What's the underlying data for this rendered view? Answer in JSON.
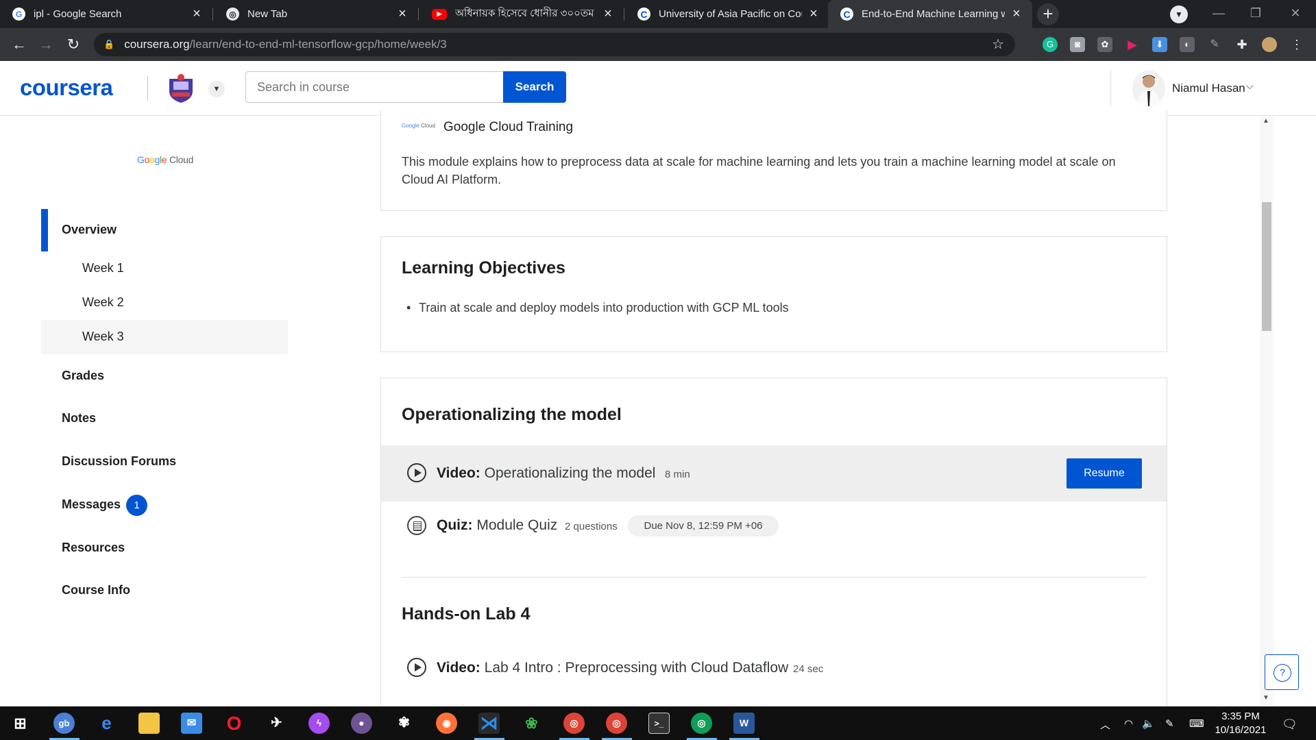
{
  "browser": {
    "tabs": [
      {
        "title": "ipl - Google Search",
        "favicon": "google-icon",
        "active": false
      },
      {
        "title": "New Tab",
        "favicon": "chrome-icon",
        "active": false
      },
      {
        "title": "অধিনায়ক হিসেবে ধোনীর ৩০০তম",
        "favicon": "youtube-icon",
        "active": false
      },
      {
        "title": "University of Asia Pacific on Cour",
        "favicon": "coursera-icon",
        "active": false
      },
      {
        "title": "End-to-End Machine Learning wi",
        "favicon": "coursera-icon",
        "active": true
      }
    ],
    "url_host": "coursera.org",
    "url_path": "/learn/end-to-end-ml-tensorflow-gcp/home/week/3"
  },
  "header": {
    "logo": "coursera",
    "search_placeholder": "Search in course",
    "search_button": "Search",
    "user_name": "Niamul Hasan"
  },
  "sidebar": {
    "partner_logo": "Google Cloud",
    "items": [
      {
        "label": "Overview",
        "active": true
      },
      {
        "label": "Week 1"
      },
      {
        "label": "Week 2"
      },
      {
        "label": "Week 3",
        "selected": true
      },
      {
        "label": "Grades"
      },
      {
        "label": "Notes"
      },
      {
        "label": "Discussion Forums"
      },
      {
        "label": "Messages",
        "badge": "1"
      },
      {
        "label": "Resources"
      },
      {
        "label": "Course Info"
      }
    ]
  },
  "main": {
    "instructor": "Google Cloud Training",
    "description": "This module explains how to preprocess data at scale for machine learning and lets you train a machine learning model at scale on Cloud AI Platform.",
    "objectives_title": "Learning Objectives",
    "objectives": [
      "Train at scale and deploy models into production with GCP ML tools"
    ],
    "section1": {
      "title": "Operationalizing the model",
      "video": {
        "type": "Video:",
        "title": "Operationalizing the model",
        "meta": "8 min",
        "action": "Resume"
      },
      "quiz": {
        "type": "Quiz:",
        "title": "Module Quiz",
        "meta": "2 questions",
        "due": "Due Nov 8, 12:59 PM +06"
      }
    },
    "section2": {
      "title": "Hands-on Lab 4",
      "video": {
        "type": "Video:",
        "title": "Lab 4 Intro : Preprocessing with Cloud Dataflow",
        "meta": "24 sec"
      }
    }
  },
  "taskbar": {
    "time": "3:35 PM",
    "date": "10/16/2021"
  },
  "colors": {
    "brand": "#0056d2",
    "chrome_dark": "#202124",
    "chrome_toolbar": "#35363a"
  }
}
